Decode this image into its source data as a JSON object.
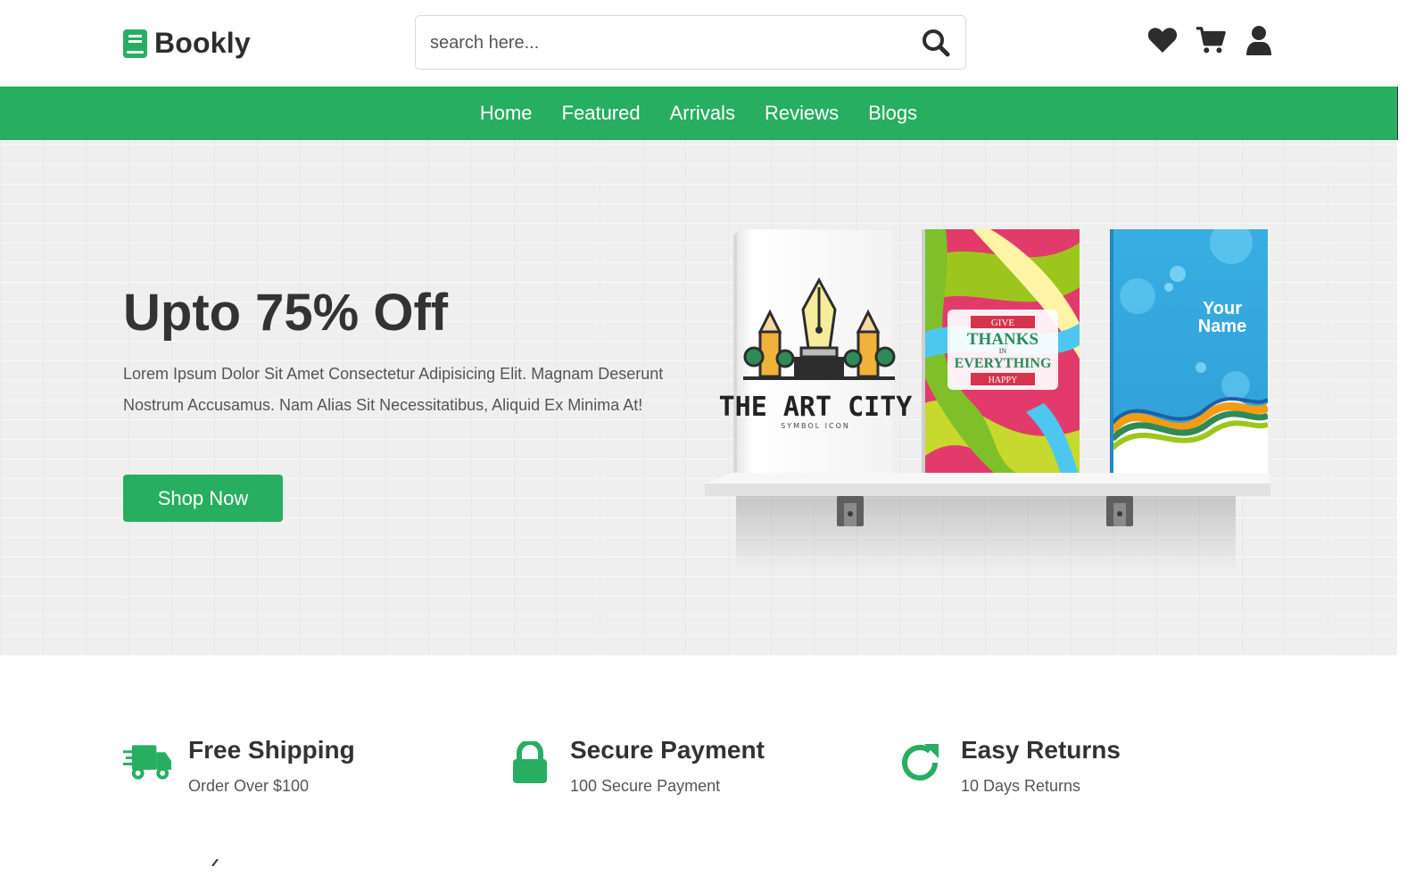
{
  "brand": {
    "name": "Bookly",
    "accent": "#27ae60"
  },
  "search": {
    "placeholder": "search here..."
  },
  "header_icons": [
    "heart-icon",
    "cart-icon",
    "user-icon"
  ],
  "nav": {
    "items": [
      "Home",
      "Featured",
      "Arrivals",
      "Reviews",
      "Blogs"
    ]
  },
  "hero": {
    "title": "Upto 75% Off",
    "text": "Lorem Ipsum Dolor Sit Amet Consectetur Adipisicing Elit. Magnam Deserunt Nostrum Accusamus. Nam Alias Sit Necessitatibus, Aliquid Ex Minima At!",
    "button": "Shop Now",
    "books": [
      {
        "title": "THE ART CITY",
        "subtitle": "SYMBOL ICON"
      },
      {
        "line1": "GIVE",
        "line2": "THANKS",
        "line3": "IN",
        "line4": "EVERYTHING",
        "line5": "HAPPY"
      },
      {
        "line1": "Your",
        "line2": "Name"
      }
    ]
  },
  "features": [
    {
      "icon": "truck-icon",
      "title": "Free Shipping",
      "text": "Order Over $100"
    },
    {
      "icon": "lock-icon",
      "title": "Secure Payment",
      "text": "100 Secure Payment"
    },
    {
      "icon": "redo-icon",
      "title": "Easy Returns",
      "text": "10 Days Returns"
    }
  ]
}
